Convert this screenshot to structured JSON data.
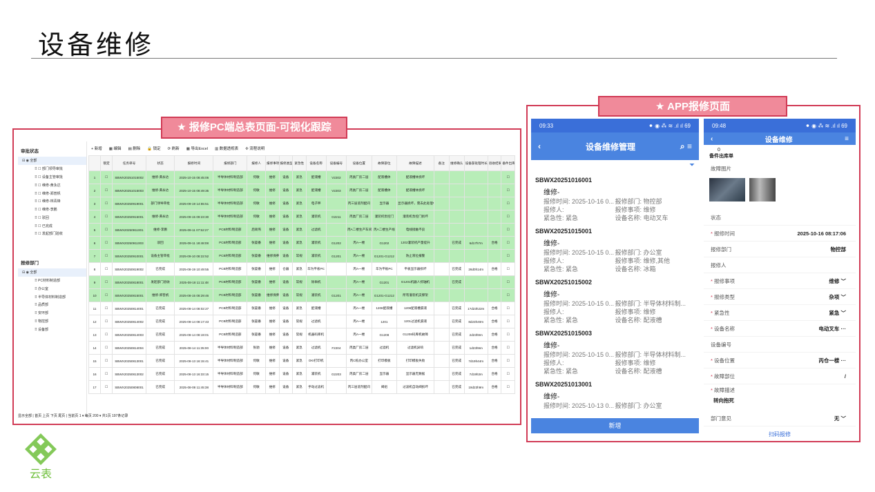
{
  "slide": {
    "title": "设备维修"
  },
  "callouts": {
    "pc": "★ 报修PC端总表页面-可视化跟踪",
    "app": "★ APP报修页面"
  },
  "pc": {
    "sidebar": {
      "status_header": "审批状态",
      "status_items": [
        "全部",
        "部门领导审批",
        "设备主管审批",
        "维修-黄永达",
        "维修-郑普帆",
        "维修-林青锋",
        "维修-李鹏",
        "驳回",
        "已完成",
        "发起部门验收"
      ],
      "dept_header": "报修部门",
      "dept_items": [
        "全部",
        "PC材料制造部",
        "办公室",
        "半导体材料制造部",
        "品质部",
        "安环部",
        "物控部",
        "设备部"
      ]
    },
    "toolbar": [
      "新增",
      "编辑",
      "删除",
      "锁定",
      "刷新",
      "导出Excel",
      "数据透视表",
      "流程说明"
    ],
    "columns": [
      "",
      "锁定",
      "任务单号",
      "状态",
      "报修时间",
      "报修部门",
      "报修人",
      "报修事项",
      "报修类型",
      "紧急性",
      "设备名称",
      "设备编号",
      "设备位置",
      "故障部位",
      "故障描述",
      "备注",
      "维修确认",
      "设备部处理时长",
      "验收结果",
      "备件出库"
    ],
    "rows": [
      {
        "no": "1",
        "code": "SBWX20251015002",
        "status": "维修-黄永达",
        "time": "2025-10-15 08:45:06",
        "dept": "半导体材料制造部",
        "person": "何敏",
        "item": "维修",
        "type": "设备",
        "urg": "紧急",
        "equip": "配液槽",
        "eqno": "V2202",
        "loc": "丙类厂房二层",
        "part": "配液槽体",
        "desc": "配液槽体损坏",
        "res": "",
        "dur": "",
        "acc": "",
        "green": true
      },
      {
        "no": "2",
        "code": "SBWX20251015003",
        "status": "维修-黄永达",
        "time": "2025-10-15 08:49:35",
        "dept": "半导体材料制造部",
        "person": "何敏",
        "item": "维修",
        "type": "设备",
        "urg": "紧急",
        "equip": "配液槽",
        "eqno": "V2203",
        "loc": "丙类厂房二层",
        "part": "配液槽体",
        "desc": "配液槽体损坏",
        "res": "",
        "dur": "",
        "acc": "",
        "green": true
      },
      {
        "no": "3",
        "code": "SBWX20250919001",
        "status": "部门领导审批",
        "time": "2025-09-19 14:55:51",
        "dept": "半导体材料制造部",
        "person": "何敏",
        "item": "维修",
        "type": "设备",
        "urg": "紧急",
        "equip": "电子秤",
        "eqno": "",
        "loc": "丙三层溶剂配间",
        "part": "显示器",
        "desc": "显示器损坏，需去此处理中",
        "res": "",
        "dur": "",
        "acc": "",
        "green": true
      },
      {
        "no": "4",
        "code": "SBWX20250915001",
        "status": "维修-黄永达",
        "time": "2025-09-15 09:23:30",
        "dept": "半导体材料制造部",
        "person": "何敏",
        "item": "维修",
        "type": "设备",
        "urg": "紧急",
        "equip": "灌装机",
        "eqno": "G2211",
        "loc": "丙类厂房二层",
        "part": "灌装机泵控门",
        "desc": "灌装机泵控门损坏",
        "res": "",
        "dur": "",
        "acc": "",
        "green": true
      },
      {
        "no": "5",
        "code": "SBWX20250911001",
        "status": "维修-李鹏",
        "time": "2025-09-11 07:52:27",
        "dept": "PCB材料制造部",
        "person": "后硕燕",
        "item": "维修",
        "type": "设备",
        "urg": "紧急",
        "equip": "过滤机",
        "eqno": "",
        "loc": "丙A二楼生产车间",
        "part": "丙A二楼生产线",
        "desc": "电线接触不良",
        "res": "",
        "dur": "",
        "acc": "",
        "green": true
      },
      {
        "no": "6",
        "code": "SBWX20250911003",
        "status": "驳回",
        "time": "2025-09-11 18:48:08",
        "dept": "PCB材料制造部",
        "person": "张晏番",
        "item": "维修",
        "type": "设备",
        "urg": "紧急",
        "equip": "灌装机",
        "eqno": "G1202",
        "loc": "丙A一楼",
        "part": "G1202",
        "desc": "1202灌装机产量提升",
        "res": "已完成",
        "dur": "6d17h7m",
        "acc": "合格",
        "green": true
      },
      {
        "no": "7",
        "code": "SBWX20250910001",
        "status": "设备主管审批",
        "time": "2025-09-10 08:22:52",
        "dept": "PCB材料制造部",
        "person": "张晏番",
        "item": "维修保养",
        "type": "设备",
        "urg": "常规",
        "equip": "灌装机",
        "eqno": "G1201",
        "loc": "丙A一楼",
        "part": "G1201-G1212",
        "desc": "防止液位报警",
        "res": "",
        "dur": "",
        "acc": "",
        "green": true
      },
      {
        "no": "8",
        "code": "SBWX20250819002",
        "status": "已完成",
        "time": "2025-08-19 10:49:55",
        "dept": "PCB材料制造部",
        "person": "张晏番",
        "item": "维修",
        "type": "仓器",
        "urg": "紧急",
        "equip": "华为平板PC",
        "eqno": "",
        "loc": "丙A一楼",
        "part": "华为平板PC",
        "desc": "平板显示器损坏",
        "res": "已完成",
        "dur": "26d0h14m",
        "acc": "合格",
        "green": false
      },
      {
        "no": "9",
        "code": "SBWX20250818001",
        "status": "发起部门验收",
        "time": "2025-08-18 11:11:48",
        "dept": "PCB材料制造部",
        "person": "张晏番",
        "item": "维修",
        "type": "设备",
        "urg": "常规",
        "equip": "除垢机",
        "eqno": "",
        "loc": "丙A一楼",
        "part": "G1201",
        "desc": "G1201机器人抓轴机",
        "res": "已完成",
        "dur": "",
        "acc": "",
        "green": true
      },
      {
        "no": "10",
        "code": "SBWX20250815001",
        "status": "维修-郑普帆",
        "time": "2025-08-15 08:29:46",
        "dept": "PCB材料制造部",
        "person": "张晏番",
        "item": "维修保养",
        "type": "设备",
        "urg": "常规",
        "equip": "灌装机",
        "eqno": "G1201",
        "loc": "丙A一楼",
        "part": "G1201-G1212",
        "desc": "所有灌装机支撑架",
        "res": "",
        "dur": "",
        "acc": "",
        "green": true
      },
      {
        "no": "11",
        "code": "SBWX20250814001",
        "status": "已完成",
        "time": "2025-08-14 08:02:27",
        "dept": "PCB材料制造部",
        "person": "张晏番",
        "item": "维修",
        "type": "设备",
        "urg": "紧急",
        "equip": "配液槽",
        "eqno": "",
        "loc": "丙A一楼",
        "part": "1208配液槽",
        "desc": "1208配液槽漏液",
        "res": "已完成",
        "dur": "1?d23h22m",
        "acc": "合格",
        "green": false
      },
      {
        "no": "12",
        "code": "SBWX20250814002",
        "status": "已完成",
        "time": "2025-08-14 08:17:43",
        "dept": "PCB材料制造部",
        "person": "张晏番",
        "item": "维修",
        "type": "设备",
        "urg": "常规",
        "equip": "过滤机",
        "eqno": "",
        "loc": "丙A一楼",
        "part": "1201",
        "desc": "1201过滤机漏液",
        "res": "已完成",
        "dur": "8d23h40m",
        "acc": "合格",
        "green": false
      },
      {
        "no": "13",
        "code": "SBWX20250814003",
        "status": "已完成",
        "time": "2025-08-14 08:19:01",
        "dept": "PCB材料制造部",
        "person": "张晏番",
        "item": "维修",
        "type": "设备",
        "urg": "常规",
        "equip": "机器码库机",
        "eqno": "",
        "loc": "丙A一楼",
        "part": "G1208",
        "desc": "G1208码库机故障",
        "res": "已完成",
        "dur": "2d23h9m",
        "acc": "合格",
        "green": false
      },
      {
        "no": "14",
        "code": "SBWX20250814004",
        "status": "已完成",
        "time": "2025-08-14 11:35:00",
        "dept": "半导体材料制造部",
        "person": "张驰",
        "item": "维修",
        "type": "设备",
        "urg": "紧急",
        "equip": "过滤机",
        "eqno": "F2204",
        "loc": "丙类厂房二层",
        "part": "过滤机",
        "desc": "过滤机异响",
        "res": "已完成",
        "dur": "1d23h9m",
        "acc": "合格",
        "green": false
      },
      {
        "no": "15",
        "code": "SBWX20250813001",
        "status": "已完成",
        "time": "2025-08-13 16:15:41",
        "dept": "半导体材料制造部",
        "person": "何敏",
        "item": "维修",
        "type": "设备",
        "urg": "紧急",
        "equip": "OKI打印机",
        "eqno": "",
        "loc": "丙C栋办公室",
        "part": "打印模板",
        "desc": "打印模板失败",
        "res": "已完成",
        "dur": "7d19h44m",
        "acc": "合格",
        "green": false
      },
      {
        "no": "16",
        "code": "SBWX20250813002",
        "status": "已完成",
        "time": "2025-08-13 16:33:15",
        "dept": "半导体材料制造部",
        "person": "何敏",
        "item": "维修",
        "type": "设备",
        "urg": "紧急",
        "equip": "灌装机",
        "eqno": "G2203",
        "loc": "丙类厂房二层",
        "part": "显示器",
        "desc": "显示器无数据",
        "res": "已完成",
        "dur": "7d19h3m",
        "acc": "合格",
        "green": false
      },
      {
        "no": "17",
        "code": "SBWX20250808001",
        "status": "已完成",
        "time": "2025-08-08 11:45:38",
        "dept": "半导体材料制造部",
        "person": "何敏",
        "item": "维修",
        "type": "设备",
        "urg": "紧急",
        "equip": "手动过滤机",
        "eqno": "",
        "loc": "丙三层溶剂配间",
        "part": "阀组",
        "desc": "过滤机自动阀损坏",
        "res": "已完成",
        "dur": "19d23h9m",
        "acc": "合格",
        "green": false
      }
    ],
    "pager": "显示全部 | 首页  上页  下页  尾页 | 当前页 1 ▾ 每页 200 ▾ 共1页  197条记录"
  },
  "app1": {
    "time": "09:33",
    "signal": "⚫ ◉ ⁂ ≋ .ıl ıl 69",
    "title": "设备维修管理",
    "records": [
      {
        "code": "SBWX20251016001",
        "time": "报修时间: 2025-10-16 0...",
        "dept": "报修部门: 物控部",
        "reporter": "报修人:",
        "item": "报修事项: 维修",
        "urg": "紧急性: 紧急",
        "equip": "设备名称: 电动叉车"
      },
      {
        "code": "SBWX20251015001",
        "time": "报修时间: 2025-10-15 0...",
        "dept": "报修部门: 办公室",
        "reporter": "报修人:",
        "item": "报修事项: 维修,其他",
        "urg": "紧急性: 紧急",
        "equip": "设备名称: 冰箱"
      },
      {
        "code": "SBWX20251015002",
        "time": "报修时间: 2025-10-15 0...",
        "dept": "报修部门: 半导体材料制...",
        "reporter": "报修人:",
        "item": "报修事项: 维修",
        "urg": "紧急性: 紧急",
        "equip": "设备名称: 配液槽"
      },
      {
        "code": "SBWX20251015003",
        "time": "报修时间: 2025-10-15 0...",
        "dept": "报修部门: 半导体材料制...",
        "reporter": "报修人:",
        "item": "报修事项: 维修",
        "urg": "紧急性: 紧急",
        "equip": "设备名称: 配液槽"
      },
      {
        "code": "SBWX20251013001",
        "time": "报修时间: 2025-10-13 0...",
        "dept": "报修部门: 办公室",
        "reporter": "",
        "item": "",
        "urg": "",
        "equip": ""
      }
    ],
    "name_prefix": "维修-",
    "add_button": "新增"
  },
  "app2": {
    "time": "09:48",
    "title": "设备维修",
    "top_count": "0",
    "top_label": "备件出库单",
    "fault_images_label": "故障图片",
    "fields": [
      {
        "label": "状态",
        "value": "",
        "req": false
      },
      {
        "label": "报修时间",
        "value": "2025-10-16 08:17:06",
        "req": true
      },
      {
        "label": "报修部门",
        "value": "物控部",
        "req": false
      },
      {
        "label": "报修人",
        "value": "",
        "req": false
      },
      {
        "label": "报修事项",
        "value": "维修 ﹀",
        "req": true
      },
      {
        "label": "报修类型",
        "value": "杂项 ﹀",
        "req": true
      },
      {
        "label": "紧急性",
        "value": "紧急 ﹀",
        "req": true
      },
      {
        "label": "设备名称",
        "value": "电动叉车 ···",
        "req": true
      },
      {
        "label": "设备编号",
        "value": "",
        "req": false
      },
      {
        "label": "设备位置",
        "value": "丙仓一楼 ···",
        "req": true
      },
      {
        "label": "故障部位",
        "value": "/",
        "req": true
      }
    ],
    "desc_label": "故障描述",
    "desc_value": "转向抱死",
    "dept_opinion_label": "部门意见",
    "dept_opinion_value": "无 ﹀",
    "scan_button": "扫码报修"
  },
  "colors": {
    "accent_red": "#d13a55",
    "callout_pink": "#f08a9a",
    "app_blue": "#4a84e0",
    "row_green": "#b8edb8",
    "logo_green": "#6fbf3c"
  }
}
